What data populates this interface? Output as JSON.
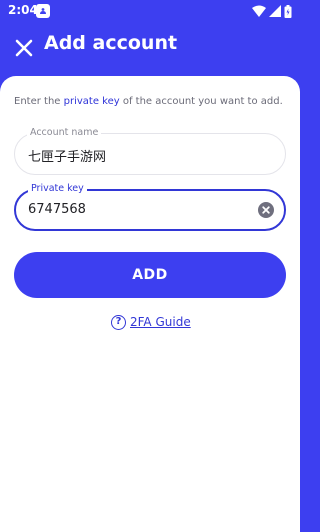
{
  "status_bar": {
    "time": "2:04",
    "icons": [
      "notification-icon",
      "wifi-icon",
      "signal-icon",
      "battery-icon"
    ]
  },
  "app_bar": {
    "title": "Add account",
    "close_icon": "close-icon"
  },
  "intro": {
    "prefix": "Enter the ",
    "highlight": "private key",
    "suffix": " of the account you want to add."
  },
  "form": {
    "account_name_label": "Account name",
    "account_name_value": "七匣子手游网",
    "private_key_label": "Private key",
    "private_key_value": "6747568",
    "clear_icon": "clear-icon"
  },
  "actions": {
    "add_label": "ADD",
    "guide_label": "2FA Guide",
    "guide_icon": "help-circle-icon"
  },
  "colors": {
    "primary": "#3d3ff0",
    "accent": "#3237d6",
    "text_muted": "#6b6b78"
  }
}
